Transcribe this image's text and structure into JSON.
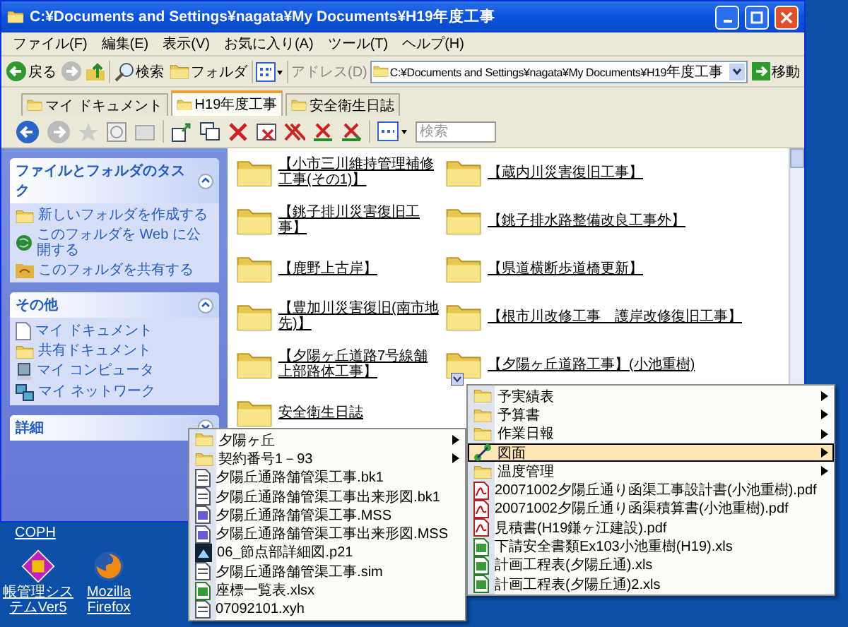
{
  "window": {
    "title": "C:¥Documents and Settings¥nagata¥My Documents¥H19年度工事"
  },
  "menu_bar": [
    "ファイル(F)",
    "編集(E)",
    "表示(V)",
    "お気に入り(A)",
    "ツール(T)",
    "ヘルプ(H)"
  ],
  "toolbar": {
    "back": "戻る",
    "search": "検索",
    "folders": "フォルダ",
    "address_label": "アドレス(D)",
    "address": "C:¥Documents and Settings¥nagata¥My Documents¥H19年度工事",
    "go": "移動"
  },
  "tabs": [
    {
      "label": "マイ ドキュメント",
      "selected": false
    },
    {
      "label": "H19年度工事",
      "selected": true
    },
    {
      "label": "安全衛生日誌",
      "selected": false
    }
  ],
  "search": {
    "placeholder": "検索"
  },
  "task_pane": [
    {
      "title": "ファイルとフォルダのタスク",
      "expanded": true,
      "items": [
        {
          "label": "新しいフォルダを作成する",
          "kind": "folder"
        },
        {
          "label": "このフォルダを Web に公開する",
          "kind": "globe"
        },
        {
          "label": "このフォルダを共有する",
          "kind": "share"
        }
      ]
    },
    {
      "title": "その他",
      "expanded": true,
      "items": [
        {
          "label": "マイ ドキュメント",
          "kind": "document"
        },
        {
          "label": "共有ドキュメント",
          "kind": "folder"
        },
        {
          "label": "マイ コンピュータ",
          "kind": "computer"
        },
        {
          "label": "マイ ネットワーク",
          "kind": "network"
        }
      ]
    },
    {
      "title": "詳細",
      "expanded": false
    }
  ],
  "folders": [
    "【小市三川維持管理補修工事(その1)】",
    "【蔵内川災害復旧工事】",
    "【銚子排川災害復旧工事】",
    "【銚子排水路整備改良工事外】",
    "【鹿野上古岸】",
    "【県道横断歩道橋更新】",
    "【豊加川災害復旧(南市地先)】",
    "【根市川改修工事　護岸改修復旧工事】",
    "【夕陽ヶ丘道路7号線舗上部路体工事】",
    "【夕陽ヶ丘道路工事】(小池重樹)",
    "安全衛生日誌"
  ],
  "menus": [
    {
      "items": [
        {
          "label": "夕陽ヶ丘",
          "kind": "folder",
          "submenu": true,
          "selected": false
        },
        {
          "label": "契約番号1－93",
          "kind": "folder",
          "submenu": true,
          "selected": false
        },
        {
          "label": "夕陽丘通路舗管渠工事.bk1",
          "kind": "file",
          "submenu": false,
          "selected": false
        },
        {
          "label": "夕陽丘通路舗管渠工事出来形図.bk1",
          "kind": "file",
          "submenu": false,
          "selected": false
        },
        {
          "label": "夕陽丘通路舗管渠工事.MSS",
          "kind": "doc",
          "submenu": false,
          "selected": false
        },
        {
          "label": "夕陽丘通路舗管渠工事出来形図.MSS",
          "kind": "doc",
          "submenu": false,
          "selected": false
        },
        {
          "label": "06_節点部詳細図.p21",
          "kind": "image",
          "submenu": false,
          "selected": false
        },
        {
          "label": "夕陽丘通路舗管渠工事.sim",
          "kind": "file",
          "submenu": false,
          "selected": false
        },
        {
          "label": "座標一覧表.xlsx",
          "kind": "excel",
          "submenu": false,
          "selected": false
        },
        {
          "label": "07092101.xyh",
          "kind": "file",
          "submenu": false,
          "selected": false
        }
      ]
    },
    {
      "items": [
        {
          "label": "予実績表",
          "kind": "folder",
          "submenu": true,
          "selected": false
        },
        {
          "label": "予算書",
          "kind": "folder",
          "submenu": true,
          "selected": false
        },
        {
          "label": "作業日報",
          "kind": "folder",
          "submenu": true,
          "selected": false
        },
        {
          "label": "図面",
          "kind": "link",
          "submenu": true,
          "selected": true
        },
        {
          "label": "温度管理",
          "kind": "folder",
          "submenu": true,
          "selected": false
        },
        {
          "label": "20071002夕陽丘通り函渠工事設計書(小池重樹).pdf",
          "kind": "pdf",
          "submenu": false,
          "selected": false
        },
        {
          "label": "20071002夕陽丘通り函渠積算書(小池重樹).pdf",
          "kind": "pdf",
          "submenu": false,
          "selected": false
        },
        {
          "label": "見積書(H19鎌ヶ江建設).pdf",
          "kind": "pdf",
          "submenu": false,
          "selected": false
        },
        {
          "label": "下請安全書類Ex103小池重樹(H19).xls",
          "kind": "excel",
          "submenu": false,
          "selected": false
        },
        {
          "label": "計画工程表(夕陽丘通).xls",
          "kind": "excel",
          "submenu": false,
          "selected": false
        },
        {
          "label": "計画工程表(夕陽丘通)2.xls",
          "kind": "excel",
          "submenu": false,
          "selected": false
        }
      ]
    }
  ],
  "desktop_icons": [
    {
      "label": "COPH",
      "kind": "covered"
    },
    {
      "label": "帳管理システムVer5",
      "kind": "app"
    },
    {
      "label": "Mozilla Firefox",
      "kind": "browser"
    }
  ]
}
